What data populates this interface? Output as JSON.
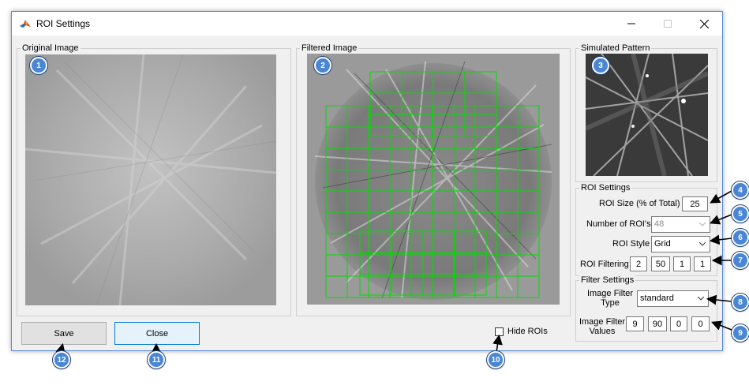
{
  "window": {
    "title": "ROI Settings"
  },
  "panels": {
    "original": {
      "title": "Original Image",
      "badge": "1"
    },
    "filtered": {
      "title": "Filtered Image",
      "badge": "2"
    },
    "simulated": {
      "title": "Simulated Pattern",
      "badge": "3"
    },
    "roi_settings": {
      "title": "ROI Settings"
    },
    "filter_settings": {
      "title": "Filter Settings"
    }
  },
  "roi": {
    "size_label": "ROI Size (% of Total)",
    "size_value": "25",
    "count_label": "Number of ROI's",
    "count_value": "48",
    "style_label": "ROI Style",
    "style_value": "Grid",
    "filtering_label": "ROI Filtering",
    "filtering_values": [
      "2",
      "50",
      "1",
      "1"
    ]
  },
  "filter": {
    "type_label": "Image Filter Type",
    "type_value": "standard",
    "values_label": "Image Filter Values",
    "values": [
      "9",
      "90",
      "0",
      "0"
    ]
  },
  "buttons": {
    "save": "Save",
    "close": "Close"
  },
  "hide_rois": {
    "label": "Hide ROIs"
  },
  "callouts": {
    "c4": "4",
    "c5": "5",
    "c6": "6",
    "c7": "7",
    "c8": "8",
    "c9": "9",
    "c10": "10",
    "c11": "11",
    "c12": "12"
  },
  "colors": {
    "roi_grid": "#00dd00",
    "badge": "#4a86d6",
    "close_button": "#e5f1fb",
    "close_border": "#0078d7"
  }
}
